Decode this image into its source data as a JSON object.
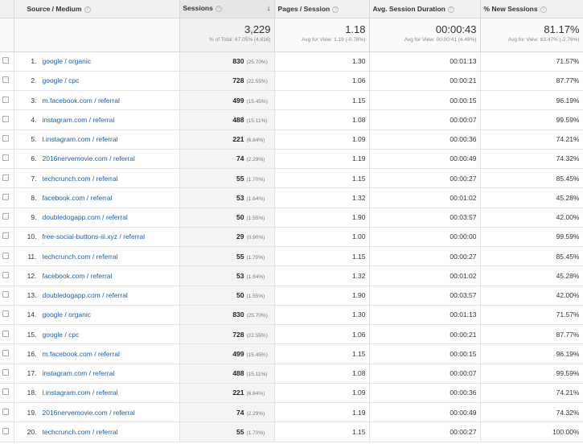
{
  "headers": {
    "source": "Source / Medium",
    "sessions": "Sessions",
    "pages": "Pages / Session",
    "duration": "Avg. Session Duration",
    "new_sessions": "% New Sessions"
  },
  "totals": {
    "sessions": "3,229",
    "sessions_sub": "% of Total: 67.05% (4,816)",
    "pages": "1.18",
    "pages_sub": "Avg for View: 1.19 (-0.78%)",
    "duration": "00:00:43",
    "duration_sub": "Avg for View: 00:00:41 (4.49%)",
    "new_sessions": "81.17%",
    "new_sessions_sub": "Avg for View: 83.47% (-2.76%)"
  },
  "rows": [
    {
      "idx": "1.",
      "source": "google / organic",
      "sessions": "830",
      "pct": "(25.70%)",
      "pages": "1.30",
      "duration": "00:01:13",
      "new": "71.57%"
    },
    {
      "idx": "2.",
      "source": "google / cpc",
      "sessions": "728",
      "pct": "(22.55%)",
      "pages": "1.06",
      "duration": "00:00:21",
      "new": "87.77%"
    },
    {
      "idx": "3.",
      "source": "m.facebook.com / referral",
      "sessions": "499",
      "pct": "(15.45%)",
      "pages": "1.15",
      "duration": "00:00:15",
      "new": "96.19%"
    },
    {
      "idx": "4.",
      "source": "instagram.com / referral",
      "sessions": "488",
      "pct": "(15.11%)",
      "pages": "1.08",
      "duration": "00:00:07",
      "new": "99.59%"
    },
    {
      "idx": "5.",
      "source": "l.instagram.com / referral",
      "sessions": "221",
      "pct": "(6.84%)",
      "pages": "1.09",
      "duration": "00:00:36",
      "new": "74.21%"
    },
    {
      "idx": "6.",
      "source": "2016nervemovie.com / referral",
      "sessions": "74",
      "pct": "(2.29%)",
      "pages": "1.19",
      "duration": "00:00:49",
      "new": "74.32%"
    },
    {
      "idx": "7.",
      "source": "techcrunch.com / referral",
      "sessions": "55",
      "pct": "(1.70%)",
      "pages": "1.15",
      "duration": "00:00:27",
      "new": "85.45%"
    },
    {
      "idx": "8.",
      "source": "facebook.com / referral",
      "sessions": "53",
      "pct": "(1.64%)",
      "pages": "1.32",
      "duration": "00:01:02",
      "new": "45.28%"
    },
    {
      "idx": "9.",
      "source": "doubledogapp.com / referral",
      "sessions": "50",
      "pct": "(1.55%)",
      "pages": "1.90",
      "duration": "00:03:57",
      "new": "42.00%"
    },
    {
      "idx": "10.",
      "source": "free-social-buttons-iii.xyz / referral",
      "sessions": "29",
      "pct": "(0.90%)",
      "pages": "1.00",
      "duration": "00:00:00",
      "new": "99.59%"
    },
    {
      "idx": "11.",
      "source": "techcrunch.com / referral",
      "sessions": "55",
      "pct": "(1.70%)",
      "pages": "1.15",
      "duration": "00:00:27",
      "new": "85.45%"
    },
    {
      "idx": "12.",
      "source": "facebook.com / referral",
      "sessions": "53",
      "pct": "(1.64%)",
      "pages": "1.32",
      "duration": "00:01:02",
      "new": "45.28%"
    },
    {
      "idx": "13.",
      "source": "doubledogapp.com / referral",
      "sessions": "50",
      "pct": "(1.55%)",
      "pages": "1.90",
      "duration": "00:03:57",
      "new": "42.00%"
    },
    {
      "idx": "14.",
      "source": "google / organic",
      "sessions": "830",
      "pct": "(25.70%)",
      "pages": "1.30",
      "duration": "00:01:13",
      "new": "71.57%"
    },
    {
      "idx": "15.",
      "source": "google / cpc",
      "sessions": "728",
      "pct": "(22.55%)",
      "pages": "1.06",
      "duration": "00:00:21",
      "new": "87.77%"
    },
    {
      "idx": "16.",
      "source": "m.facebook.com / referral",
      "sessions": "499",
      "pct": "(15.45%)",
      "pages": "1.15",
      "duration": "00:00:15",
      "new": "96.19%"
    },
    {
      "idx": "17.",
      "source": "instagram.com / referral",
      "sessions": "488",
      "pct": "(15.11%)",
      "pages": "1.08",
      "duration": "00:00:07",
      "new": "99.59%"
    },
    {
      "idx": "18.",
      "source": "l.instagram.com / referral",
      "sessions": "221",
      "pct": "(6.84%)",
      "pages": "1.09",
      "duration": "00:00:36",
      "new": "74.21%"
    },
    {
      "idx": "19.",
      "source": "2016nervemovie.com / referral",
      "sessions": "74",
      "pct": "(2.29%)",
      "pages": "1.19",
      "duration": "00:00:49",
      "new": "74.32%"
    },
    {
      "idx": "20.",
      "source": "techcrunch.com / referral",
      "sessions": "55",
      "pct": "(1.70%)",
      "pages": "1.15",
      "duration": "00:00:27",
      "new": "100.00%"
    }
  ],
  "icons": {
    "help": "?",
    "sort": "↓"
  }
}
